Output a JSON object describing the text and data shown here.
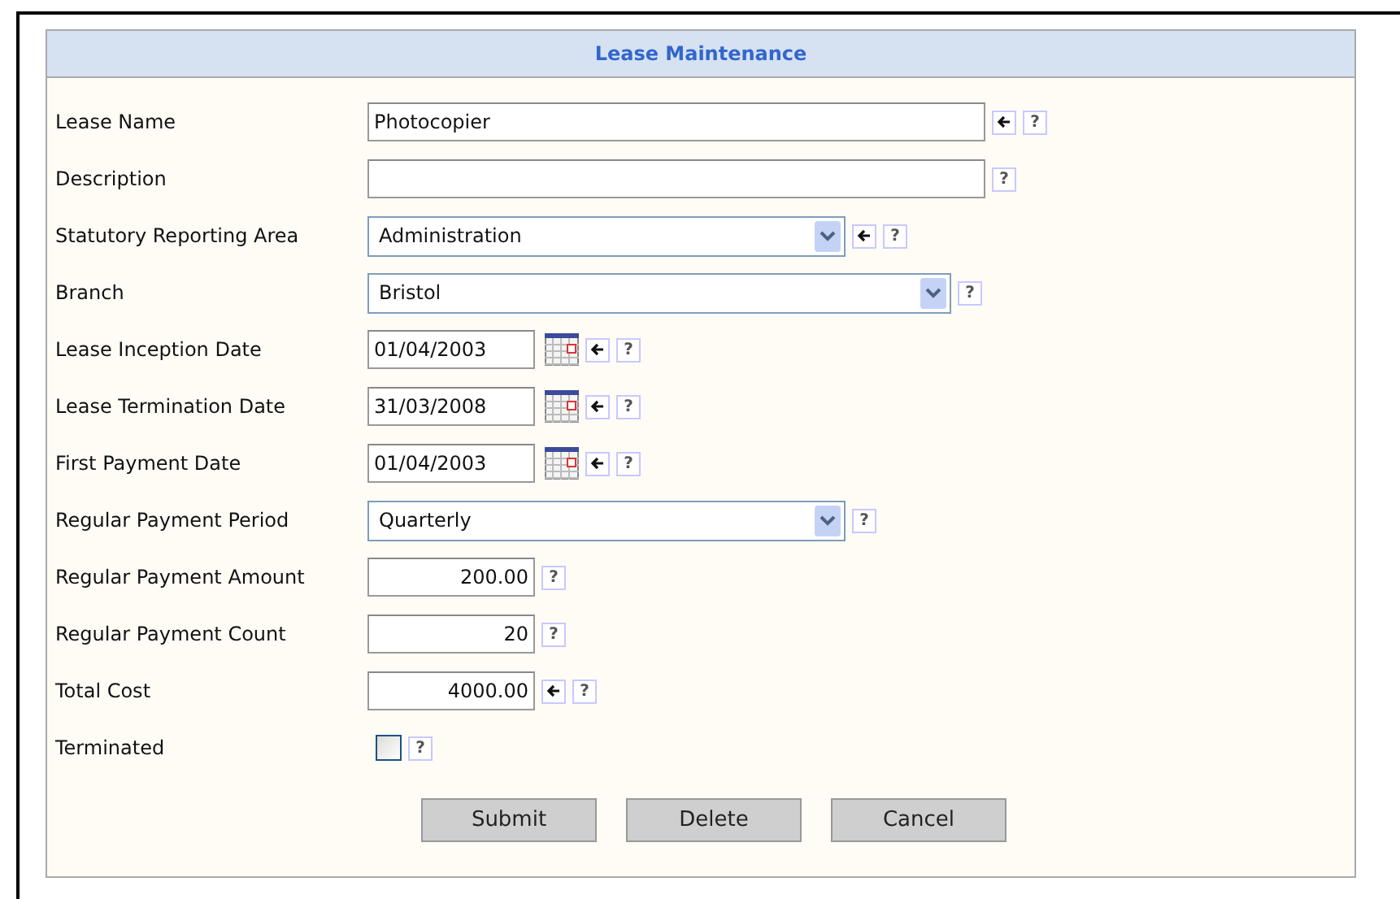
{
  "title": "Lease Maintenance",
  "fields": [
    {
      "label": "Lease Name",
      "kind": "text",
      "value": "Photocopier",
      "arrow": true,
      "help": "?"
    },
    {
      "label": "Description",
      "kind": "text",
      "arrow": false,
      "help": "?"
    },
    {
      "label": "Statutory Reporting Area",
      "kind": "select",
      "value": "Administration",
      "arrow": true,
      "help": "?"
    },
    {
      "label": "Branch",
      "kind": "select",
      "value": "Bristol",
      "arrow": false,
      "help": "?"
    },
    {
      "label": "Lease Inception Date",
      "kind": "date",
      "value": "01/04/2003",
      "arrow": true,
      "help": "?"
    },
    {
      "label": "Lease Termination Date",
      "kind": "date",
      "value": "31/03/2008",
      "arrow": true,
      "help": "?"
    },
    {
      "label": "First Payment Date",
      "kind": "date",
      "value": "01/04/2003",
      "arrow": true,
      "help": "?"
    },
    {
      "label": "Regular Payment Period",
      "kind": "select",
      "value": "Quarterly",
      "arrow": false,
      "help": "?"
    },
    {
      "label": "Regular Payment Amount",
      "kind": "number",
      "value": "200.00",
      "arrow": false,
      "help": "?"
    },
    {
      "label": "Regular Payment Count",
      "kind": "number",
      "value": "20",
      "arrow": false,
      "help": "?"
    },
    {
      "label": "Total Cost",
      "kind": "number",
      "value": "4000.00",
      "arrow": true,
      "help": "?"
    },
    {
      "label": "Terminated",
      "kind": "checkbox",
      "checked": false,
      "arrow": false,
      "help": "?"
    }
  ],
  "buttons": [
    "Submit",
    "Delete",
    "Cancel"
  ]
}
